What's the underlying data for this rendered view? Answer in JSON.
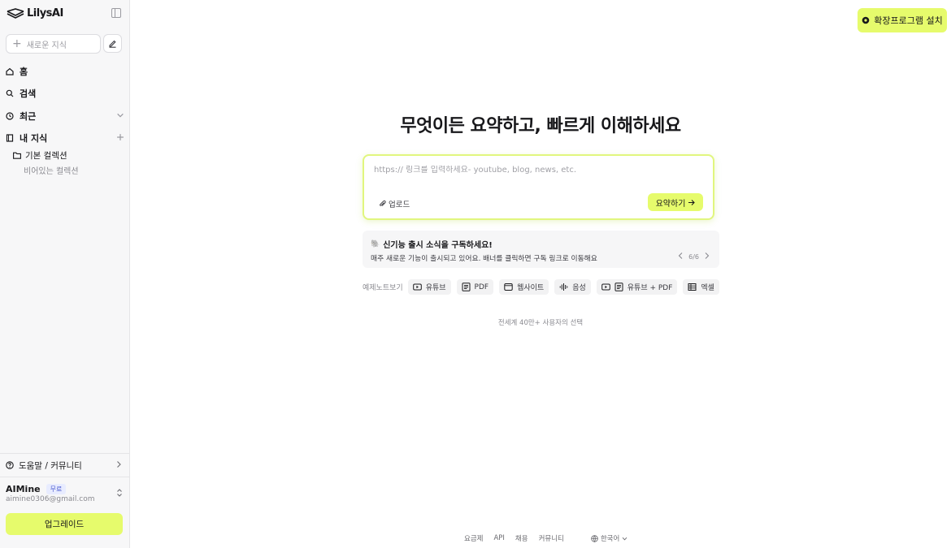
{
  "app": {
    "logo_text": "LilysAI"
  },
  "sidebar": {
    "new_knowledge_placeholder": "새로운 지식",
    "nav": [
      {
        "label": "홈",
        "icon": "home-icon"
      },
      {
        "label": "검색",
        "icon": "search-icon"
      },
      {
        "label": "최근",
        "icon": "clock-icon"
      },
      {
        "label": "내 지식",
        "icon": "book-icon"
      }
    ],
    "collection": {
      "name": "기본 컬렉션",
      "status": "비어있는 컬렉션"
    },
    "help_label": "도움말 / 커뮤니티",
    "user": {
      "name": "AIMine",
      "plan_badge": "무료",
      "email": "aimine0306@gmail.com"
    },
    "upgrade_label": "업그레이드"
  },
  "header": {
    "extension_button": "확장프로그램 설치"
  },
  "main": {
    "headline": "무엇이든 요약하고, 빠르게 이해하세요",
    "url_placeholder": "https:// 링크를 입력하세요- youtube, blog, news, etc.",
    "upload_label": "업로드",
    "summarize_label": "요약하기",
    "banner": {
      "emoji": "🐘",
      "title": "신기능 출시 소식을 구독하세요!",
      "description": "매주 새로운 기능이 출시되고 있어요. 배너를 클릭하면 구독 링크로 이동해요",
      "pager": "6/6"
    },
    "examples_label": "예제노트보기",
    "examples": [
      {
        "label": "유튜브",
        "icon": "youtube-icon"
      },
      {
        "label": "PDF",
        "icon": "document-icon"
      },
      {
        "label": "웹사이트",
        "icon": "browser-icon"
      },
      {
        "label": "음성",
        "icon": "audio-wave-icon"
      },
      {
        "label": "유튜브 + PDF",
        "icon": "youtube-pdf-icon"
      },
      {
        "label": "엑셀",
        "icon": "table-icon"
      }
    ],
    "users_note": "전세계 40만+ 사용자의 선택"
  },
  "footer": {
    "links": [
      "요금제",
      "API",
      "채용",
      "커뮤니티"
    ],
    "language": "한국어"
  },
  "colors": {
    "accent": "#e6fb6c",
    "sidebar_bg": "#f7f7f8",
    "input_border": "#e1f67e"
  }
}
